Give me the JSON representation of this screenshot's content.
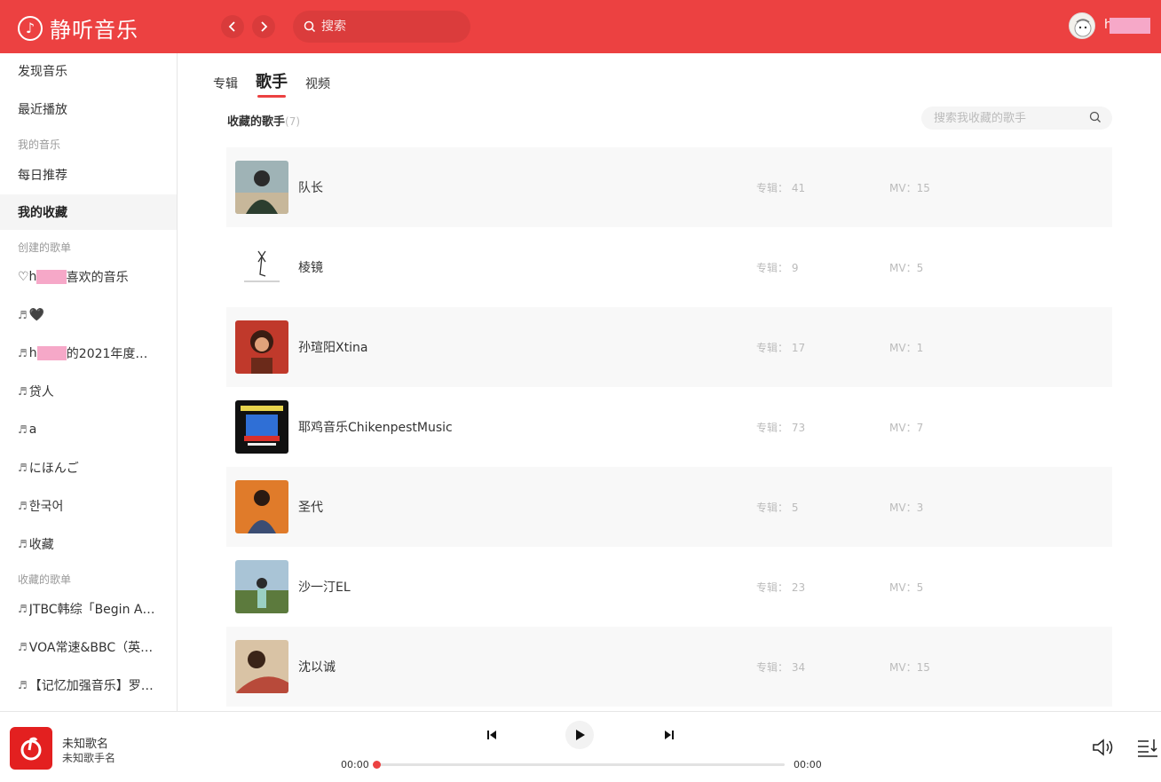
{
  "header": {
    "app_name": "静听音乐",
    "search_placeholder": "搜索",
    "username": "h"
  },
  "sidebar": {
    "discover": "发现音乐",
    "recent": "最近播放",
    "my_music_section": "我的音乐",
    "daily": "每日推荐",
    "my_collection": "我的收藏",
    "created_section": "创建的歌单",
    "created": [
      {
        "prefix": "♡h",
        "suffix": "喜欢的音乐"
      },
      {
        "prefix": "",
        "label": "🖤"
      },
      {
        "prefix": "h",
        "suffix": "的2021年度…"
      },
      {
        "label": "贷人"
      },
      {
        "label": "a"
      },
      {
        "label": "にほんご"
      },
      {
        "label": "한국어"
      },
      {
        "label": "收藏"
      }
    ],
    "collected_section": "收藏的歌单",
    "collected": [
      {
        "label": "JTBC韩综「Begin A…"
      },
      {
        "label": "VOA常速&BBC（英…"
      },
      {
        "label": "【记忆加强音乐】罗…"
      }
    ]
  },
  "tabs": [
    "专辑",
    "歌手",
    "视频"
  ],
  "active_tab": "歌手",
  "collect": {
    "title": "收藏的歌手",
    "count": "(7)",
    "search_placeholder": "搜索我收藏的歌手"
  },
  "singers": [
    {
      "name": "队长",
      "album": "专辑：  41",
      "mv": "MV：15",
      "img": "a"
    },
    {
      "name": "棱镜",
      "album": "专辑：  9",
      "mv": "MV：5",
      "img": "b"
    },
    {
      "name": "孙瑄阳Xtina",
      "album": "专辑：  17",
      "mv": "MV：1",
      "img": "c"
    },
    {
      "name": "耶鸡音乐ChikenpestMusic",
      "album": "专辑：  73",
      "mv": "MV：7",
      "img": "d"
    },
    {
      "name": "圣代",
      "album": "专辑：  5",
      "mv": "MV：3",
      "img": "e"
    },
    {
      "name": "沙一汀EL",
      "album": "专辑：  23",
      "mv": "MV：5",
      "img": "f"
    },
    {
      "name": "沈以诚",
      "album": "专辑：  34",
      "mv": "MV：15",
      "img": "g"
    }
  ],
  "player": {
    "song": "未知歌名",
    "artist": "未知歌手名",
    "time_current": "00:00",
    "time_total": "00:00",
    "progress": 0
  },
  "colors": {
    "accent": "#ec4141"
  }
}
